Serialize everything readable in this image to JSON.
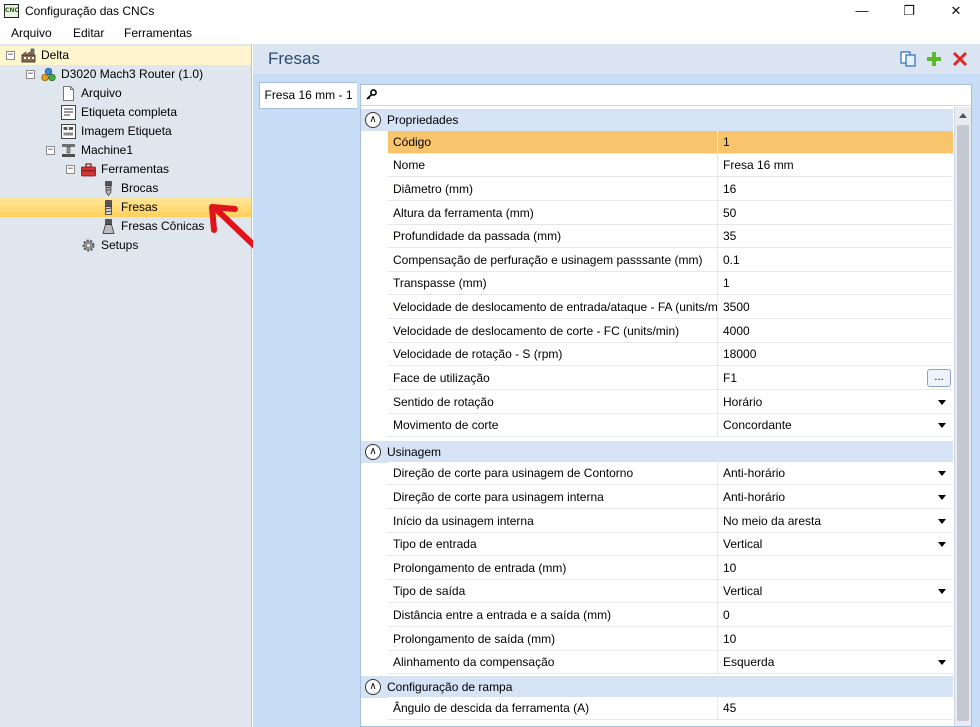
{
  "window": {
    "title": "Configuração das CNCs",
    "app_icon_text": "CNC",
    "minimize": "—",
    "maximize": "❐",
    "close": "✕"
  },
  "menu": [
    "Arquivo",
    "Editar",
    "Ferramentas"
  ],
  "tree": [
    {
      "label": "Delta",
      "expander": "−"
    },
    {
      "label": "D3020 Mach3 Router (1.0)",
      "expander": "−"
    },
    {
      "label": "Arquivo"
    },
    {
      "label": "Etiqueta completa"
    },
    {
      "label": "Imagem Etiqueta"
    },
    {
      "label": "Machine1",
      "expander": "−"
    },
    {
      "label": "Ferramentas",
      "expander": "−"
    },
    {
      "label": "Brocas"
    },
    {
      "label": "Fresas"
    },
    {
      "label": "Fresas Cônicas"
    },
    {
      "label": "Setups"
    }
  ],
  "panel": {
    "title": "Fresas",
    "tab": "Fresa 16 mm - 1"
  },
  "grid": {
    "sections": [
      {
        "label": "Propriedades",
        "toggle": "∧"
      },
      {
        "label": "Usinagem",
        "toggle": "∧"
      },
      {
        "label": "Configuração de rampa",
        "toggle": "∧"
      }
    ],
    "props": [
      {
        "name": "Código",
        "value": "1"
      },
      {
        "name": "Nome",
        "value": "Fresa 16 mm"
      },
      {
        "name": "Diâmetro (mm)",
        "value": "16"
      },
      {
        "name": "Altura da ferramenta (mm)",
        "value": "50"
      },
      {
        "name": "Profundidade da passada (mm)",
        "value": "35"
      },
      {
        "name": "Compensação de perfuração e usinagem passsante (mm)",
        "value": "0.1"
      },
      {
        "name": "Transpasse (mm)",
        "value": "1"
      },
      {
        "name": "Velocidade de deslocamento de entrada/ataque - FA (units/min)",
        "value": "3500"
      },
      {
        "name": "Velocidade de deslocamento de corte - FC (units/min)",
        "value": "4000"
      },
      {
        "name": "Velocidade de rotação - S (rpm)",
        "value": "18000"
      },
      {
        "name": "Face de utilização",
        "value": "F1",
        "ellipsis": "..."
      },
      {
        "name": "Sentido de rotação",
        "value": "Horário"
      },
      {
        "name": "Movimento de corte",
        "value": "Concordante"
      }
    ],
    "usinagem": [
      {
        "name": "Direção de corte para usinagem de Contorno",
        "value": "Anti-horário"
      },
      {
        "name": "Direção de corte para usinagem interna",
        "value": "Anti-horário"
      },
      {
        "name": "Início da usinagem interna",
        "value": "No meio da aresta"
      },
      {
        "name": "Tipo de entrada",
        "value": "Vertical"
      },
      {
        "name": "Prolongamento de entrada (mm)",
        "value": "10"
      },
      {
        "name": "Tipo de saída",
        "value": "Vertical"
      },
      {
        "name": "Distância entre a entrada e a saída (mm)",
        "value": "0"
      },
      {
        "name": "Prolongamento de saída (mm)",
        "value": "10"
      },
      {
        "name": "Alinhamento da compensação",
        "value": "Esquerda"
      }
    ],
    "rampa": [
      {
        "name": "Ângulo de descida da ferramenta (A)",
        "value": "45"
      }
    ]
  },
  "colors": {
    "selected": "#ffcf5a",
    "highlight_row": "#f8c56d",
    "panel_bg": "#c7dcf5",
    "title": "#2c4a70",
    "arrow": "#e0121b"
  },
  "icons": [
    "app-icon",
    "factory-icon",
    "machine-cluster-icon",
    "document-icon",
    "label-icon",
    "label-image-icon",
    "machine-icon",
    "toolbox-icon",
    "drill-bit-icon",
    "end-mill-icon",
    "conical-mill-icon",
    "gear-icon",
    "copy-icon",
    "add-icon",
    "delete-icon",
    "key-icon"
  ]
}
